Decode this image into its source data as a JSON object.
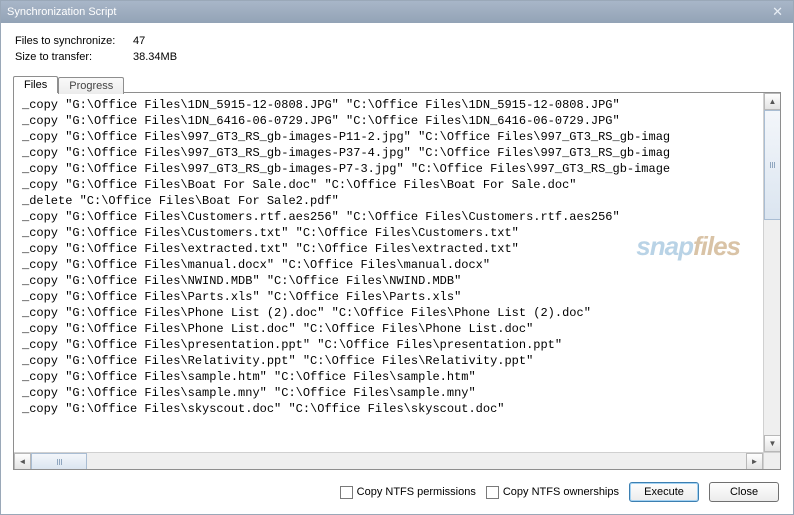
{
  "window": {
    "title": "Synchronization Script"
  },
  "summary": {
    "files_label": "Files to synchronize:",
    "files_value": "47",
    "size_label": "Size to transfer:",
    "size_value": "38.34MB"
  },
  "tabs": {
    "files": "Files",
    "progress": "Progress"
  },
  "script_lines": [
    "_copy \"G:\\Office Files\\1DN_5915-12-0808.JPG\" \"C:\\Office Files\\1DN_5915-12-0808.JPG\"",
    "_copy \"G:\\Office Files\\1DN_6416-06-0729.JPG\" \"C:\\Office Files\\1DN_6416-06-0729.JPG\"",
    "_copy \"G:\\Office Files\\997_GT3_RS_gb-images-P11-2.jpg\" \"C:\\Office Files\\997_GT3_RS_gb-imag",
    "_copy \"G:\\Office Files\\997_GT3_RS_gb-images-P37-4.jpg\" \"C:\\Office Files\\997_GT3_RS_gb-imag",
    "_copy \"G:\\Office Files\\997_GT3_RS_gb-images-P7-3.jpg\" \"C:\\Office Files\\997_GT3_RS_gb-image",
    "_copy \"G:\\Office Files\\Boat For Sale.doc\" \"C:\\Office Files\\Boat For Sale.doc\"",
    "_delete \"C:\\Office Files\\Boat For Sale2.pdf\"",
    "_copy \"G:\\Office Files\\Customers.rtf.aes256\" \"C:\\Office Files\\Customers.rtf.aes256\"",
    "_copy \"G:\\Office Files\\Customers.txt\" \"C:\\Office Files\\Customers.txt\"",
    "_copy \"G:\\Office Files\\extracted.txt\" \"C:\\Office Files\\extracted.txt\"",
    "_copy \"G:\\Office Files\\manual.docx\" \"C:\\Office Files\\manual.docx\"",
    "_copy \"G:\\Office Files\\NWIND.MDB\" \"C:\\Office Files\\NWIND.MDB\"",
    "_copy \"G:\\Office Files\\Parts.xls\" \"C:\\Office Files\\Parts.xls\"",
    "_copy \"G:\\Office Files\\Phone List (2).doc\" \"C:\\Office Files\\Phone List (2).doc\"",
    "_copy \"G:\\Office Files\\Phone List.doc\" \"C:\\Office Files\\Phone List.doc\"",
    "_copy \"G:\\Office Files\\presentation.ppt\" \"C:\\Office Files\\presentation.ppt\"",
    "_copy \"G:\\Office Files\\Relativity.ppt\" \"C:\\Office Files\\Relativity.ppt\"",
    "_copy \"G:\\Office Files\\sample.htm\" \"C:\\Office Files\\sample.htm\"",
    "_copy \"G:\\Office Files\\sample.mny\" \"C:\\Office Files\\sample.mny\"",
    "_copy \"G:\\Office Files\\skyscout.doc\" \"C:\\Office Files\\skyscout.doc\""
  ],
  "watermark": {
    "part1": "snap",
    "part2": "files"
  },
  "footer": {
    "copy_perms": "Copy NTFS permissions",
    "copy_owners": "Copy NTFS ownerships",
    "execute": "Execute",
    "close": "Close"
  }
}
